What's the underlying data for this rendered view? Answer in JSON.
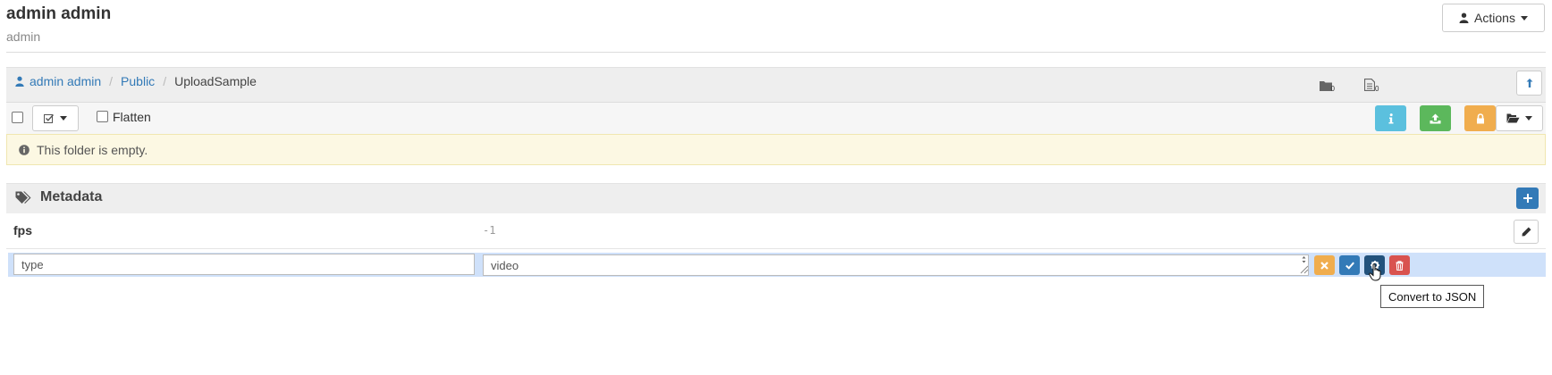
{
  "header": {
    "title": "admin admin",
    "subtitle": "admin",
    "actions_label": "Actions"
  },
  "breadcrumb": {
    "items": [
      "admin admin",
      "Public",
      "UploadSample"
    ],
    "folder_count": "0",
    "item_count": "0"
  },
  "toolbar": {
    "flatten_label": "Flatten"
  },
  "empty_message": "This folder is empty.",
  "metadata": {
    "title": "Metadata",
    "rows": [
      {
        "key": "fps",
        "value": "-1"
      }
    ],
    "edit_row": {
      "key_value": "type",
      "value_value": "video"
    },
    "tooltip": "Convert to JSON"
  },
  "colors": {
    "link": "#337ab7",
    "info": "#5bc0de",
    "success": "#5cb85c",
    "warning": "#f0ad4e",
    "danger": "#d9534f",
    "primary": "#337ab7",
    "alert_bg": "#fcf8e3",
    "edit_row_bg": "#cfe1fa"
  },
  "icons": {
    "user": "user-icon",
    "folder_count": "folder-icon",
    "item_count": "file-icon",
    "upload": "upload-icon",
    "check": "check-square-icon",
    "info": "info-icon",
    "lock": "lock-icon",
    "folder_open": "folder-open-icon",
    "tags": "tags-icon",
    "plus": "plus-icon",
    "pencil": "pencil-icon",
    "cancel": "times-icon",
    "save": "check-icon",
    "convert": "gear-icon",
    "delete": "trash-icon"
  }
}
